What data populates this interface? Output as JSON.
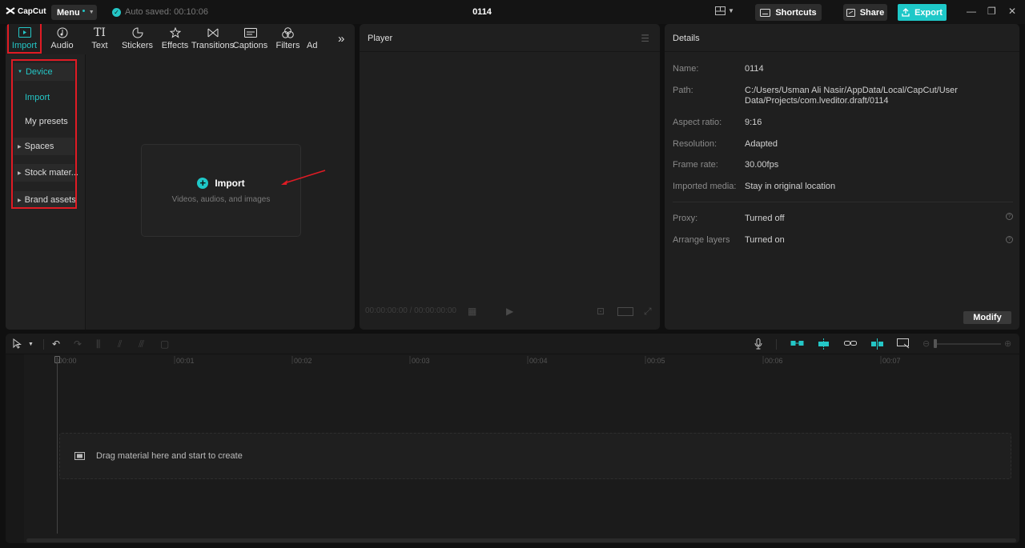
{
  "app": {
    "name": "CapCut",
    "project_title": "0114"
  },
  "titlebar": {
    "menu_label": "Menu",
    "autosave_text": "Auto saved: 00:10:06",
    "shortcuts_label": "Shortcuts",
    "share_label": "Share",
    "export_label": "Export"
  },
  "tabs": [
    {
      "label": "Import",
      "icon": "import-icon",
      "active": true
    },
    {
      "label": "Audio",
      "icon": "audio-icon"
    },
    {
      "label": "Text",
      "icon": "text-icon",
      "glyph": "TI"
    },
    {
      "label": "Stickers",
      "icon": "stickers-icon"
    },
    {
      "label": "Effects",
      "icon": "effects-icon"
    },
    {
      "label": "Transitions",
      "icon": "transitions-icon"
    },
    {
      "label": "Captions",
      "icon": "captions-icon"
    },
    {
      "label": "Filters",
      "icon": "filters-icon"
    },
    {
      "label": "Ad",
      "icon": "adjustment-icon"
    }
  ],
  "sidebar": {
    "device": "Device",
    "import": "Import",
    "my_presets": "My presets",
    "spaces": "Spaces",
    "stock": "Stock mater...",
    "brand": "Brand assets"
  },
  "media": {
    "import_label": "Import",
    "import_sub": "Videos, audios, and images"
  },
  "player": {
    "title": "Player",
    "timecode": "00:00:00:00 / 00:00:00:00"
  },
  "details": {
    "title": "Details",
    "rows": [
      {
        "label": "Name:",
        "value": "0114"
      },
      {
        "label": "Path:",
        "value": "C:/Users/Usman Ali Nasir/AppData/Local/CapCut/User Data/Projects/com.lveditor.draft/0114"
      },
      {
        "label": "Aspect ratio:",
        "value": "9:16"
      },
      {
        "label": "Resolution:",
        "value": "Adapted"
      },
      {
        "label": "Frame rate:",
        "value": "30.00fps"
      },
      {
        "label": "Imported media:",
        "value": "Stay in original location"
      },
      {
        "label": "Proxy:",
        "value": "Turned off"
      },
      {
        "label": "Arrange layers",
        "value": "Turned on"
      }
    ],
    "modify_label": "Modify"
  },
  "timeline": {
    "ticks": [
      "00:00",
      "00:01",
      "00:02",
      "00:03",
      "00:04",
      "00:05",
      "00:06",
      "00:07"
    ],
    "drop_text": "Drag material here and start to create"
  },
  "colors": {
    "accent": "#1ec8c8",
    "highlight": "#e01b24",
    "panel": "#1f1f1f"
  }
}
